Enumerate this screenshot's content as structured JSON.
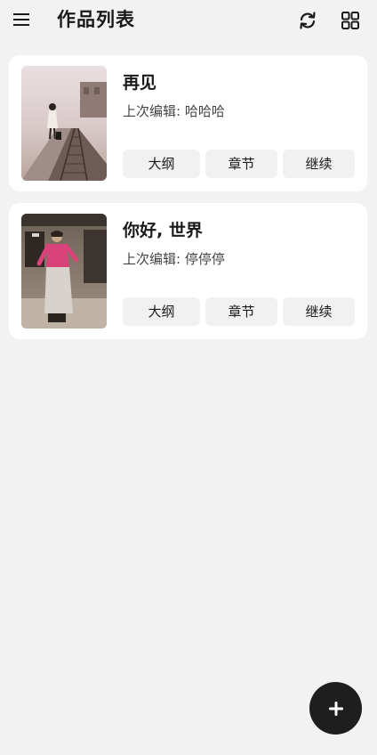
{
  "header": {
    "menu_icon": "hamburger-menu-icon",
    "title": "作品列表",
    "refresh_icon": "refresh-icon",
    "grid_icon": "grid-view-icon"
  },
  "works": [
    {
      "title": "再见",
      "last_edit": "上次编辑: 哈哈哈",
      "actions": {
        "outline": "大纲",
        "chapters": "章节",
        "continue": "继续"
      }
    },
    {
      "title": "你好, 世界",
      "last_edit": "上次编辑: 停停停",
      "actions": {
        "outline": "大纲",
        "chapters": "章节",
        "continue": "继续"
      }
    }
  ],
  "fab": {
    "icon": "plus-icon"
  },
  "colors": {
    "background": "#f2f2f2",
    "card": "#ffffff",
    "fab": "#1e1e1e",
    "button_bg": "#f1f1f1"
  }
}
